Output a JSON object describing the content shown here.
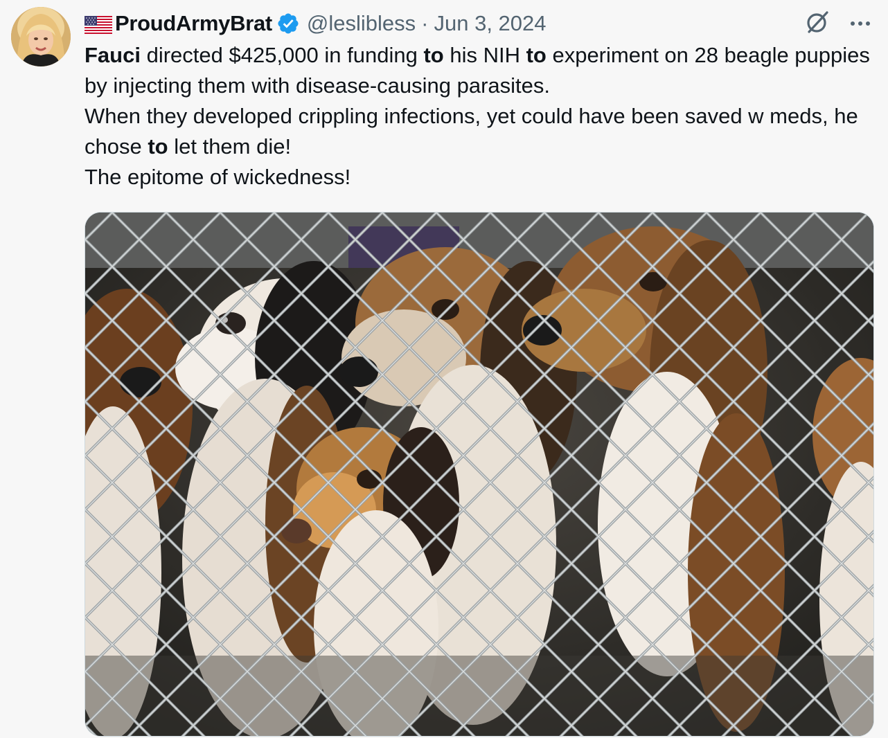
{
  "tweet": {
    "flag_icon": "us-flag-icon",
    "display_name": "ProudArmyBrat",
    "verified_icon": "verified-badge-icon",
    "handle": "@leslibless",
    "separator": "·",
    "date": "Jun 3, 2024",
    "grok_icon": "grok-icon",
    "more_icon": "more-options-icon",
    "text": {
      "line1": {
        "w1": "Fauci",
        "t1": " directed $425,000 in funding ",
        "w2": "to",
        "t2": " his NIH ",
        "w3": "to",
        "t3": " experiment on 28 beagle puppies by injecting them with disease-causing parasites."
      },
      "line2": {
        "t1": "When they developed crippling infections, yet could have been saved w meds, he chose ",
        "w1": "to",
        "t2": " let them die!"
      },
      "line3": "The epitome of wickedness!"
    },
    "media_alt": "beagle-puppies-in-cage-photo"
  },
  "colors": {
    "text_primary": "#0f1419",
    "text_secondary": "#536471",
    "verified_blue": "#1d9bf0",
    "background": "#f7f7f7"
  }
}
